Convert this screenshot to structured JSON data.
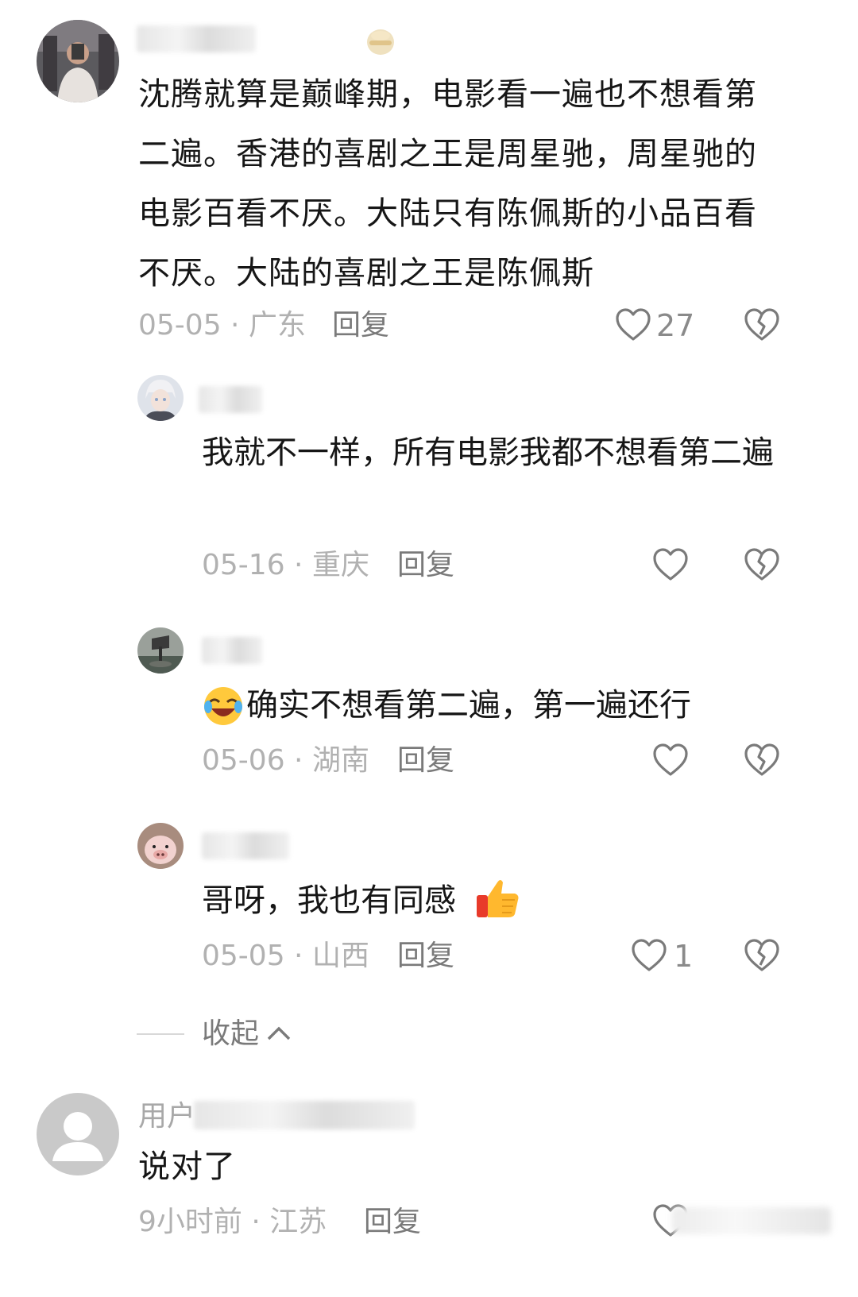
{
  "comments": [
    {
      "text": "沈腾就算是巅峰期，电影看一遍也不想看第二遍。香港的喜剧之王是周星驰，周星驰的电影百看不厌。大陆只有陈佩斯的小品百看不厌。大陆的喜剧之王是陈佩斯",
      "date_location": "05-05 · 广东",
      "reply_label": "回复",
      "likes": "27"
    },
    {
      "text": "我就不一样，所有电影我都不想看第二遍",
      "date_location": "05-16 · 重庆",
      "reply_label": "回复",
      "likes": ""
    },
    {
      "text": "确实不想看第二遍，第一遍还行",
      "date_location": "05-06 · 湖南",
      "reply_label": "回复",
      "likes": ""
    },
    {
      "text": "哥呀，我也有同感",
      "date_location": "05-05 · 山西",
      "reply_label": "回复",
      "likes": "1"
    },
    {
      "username": "用户",
      "text": "说对了",
      "date_location": "9小时前 · 江苏",
      "reply_label": "回复"
    }
  ],
  "collapse_label": "收起",
  "icons": [
    "heart-icon",
    "broken-heart-icon",
    "chevron-up-icon",
    "laughing-emoji-icon",
    "thumbs-up-emoji-icon",
    "default-avatar-icon"
  ],
  "colors": {
    "meta_text": "#b1b1b1",
    "reply_text": "#7a7a7a",
    "icon_stroke": "#7a7a7a"
  }
}
